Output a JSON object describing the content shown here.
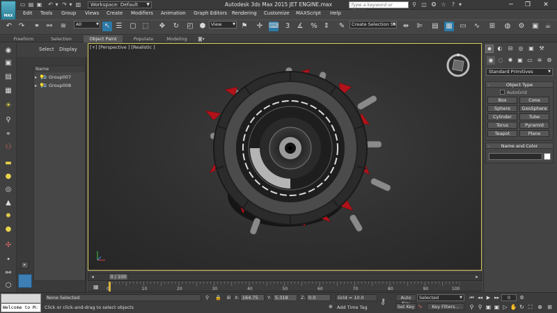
{
  "titlebar": {
    "app_logo": "MAX",
    "workspace_label": "Workspace: Default",
    "app_title": "Autodesk 3ds Max  2015     JET ENGINE.max",
    "search_placeholder": "Type a keyword or phrase"
  },
  "menu": [
    "Edit",
    "Tools",
    "Group",
    "Views",
    "Create",
    "Modifiers",
    "Animation",
    "Graph Editors",
    "Rendering",
    "Customize",
    "MAXScript",
    "Help"
  ],
  "toolbar": {
    "selection_filter": "All",
    "reference_coord": "View",
    "named_selection": "Create Selection Se",
    "snap_label": "3",
    "percent_label": "%"
  },
  "ribbon_tabs": [
    "Freeform",
    "Selection",
    "Object Paint",
    "Populate",
    "Modeling"
  ],
  "ribbon_active": "Object Paint",
  "explorer": {
    "tabs": [
      "Select",
      "Display"
    ],
    "column_header": "Name",
    "items": [
      "Group007",
      "Group008"
    ]
  },
  "viewport": {
    "label": "[+] [Perspective ] [Realistic ]"
  },
  "timeline": {
    "slider_label": "0 / 100",
    "ticks": [
      "0",
      "10",
      "20",
      "30",
      "40",
      "50",
      "60",
      "70",
      "80",
      "90",
      "100"
    ]
  },
  "command_panel": {
    "category_dropdown": "Standard Primitives",
    "object_type_title": "Object Type",
    "autogrid_label": "AutoGrid",
    "object_buttons": [
      "Box",
      "Cone",
      "Sphere",
      "GeoSphere",
      "Cylinder",
      "Tube",
      "Torus",
      "Pyramid",
      "Teapot",
      "Plane"
    ],
    "name_color_title": "Name and Color",
    "color_swatch": "#ffffff"
  },
  "status": {
    "maxscript_text": "Welcome to M:",
    "selection_status": "None Selected",
    "prompt": "Click or click-and-drag to select objects",
    "x_label": "X:",
    "x_value": "164.75",
    "y_label": "Y:",
    "y_value": "5.318",
    "z_label": "Z:",
    "z_value": "0.0",
    "grid": "Grid = 10.0",
    "add_time_tag": "Add Time Tag",
    "auto_key": "Auto Key",
    "selected_dd": "Selected",
    "set_key": "Set Key",
    "key_filters": "Key Filters...",
    "frame": "0"
  }
}
